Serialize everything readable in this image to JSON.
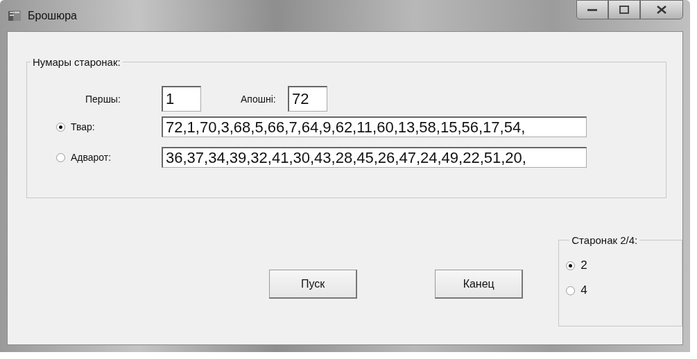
{
  "window": {
    "title": "Брошюра"
  },
  "page_numbers": {
    "legend": "Нумары старонак:",
    "first": {
      "label": "Першы:",
      "value": "1"
    },
    "last": {
      "label": "Апошні:",
      "value": "72"
    },
    "sides": [
      {
        "label": "Твар:",
        "value": "72,1,70,3,68,5,66,7,64,9,62,11,60,13,58,15,56,17,54,",
        "selected": true
      },
      {
        "label": "Адварот:",
        "value": "36,37,34,39,32,41,30,43,28,45,26,47,24,49,22,51,20,",
        "selected": false
      }
    ]
  },
  "buttons": [
    "Пуск",
    "Канец"
  ],
  "pages_per_sheet": {
    "legend": "Старонак 2/4:",
    "options": [
      {
        "label": "2",
        "selected": true
      },
      {
        "label": "4",
        "selected": false
      }
    ]
  }
}
